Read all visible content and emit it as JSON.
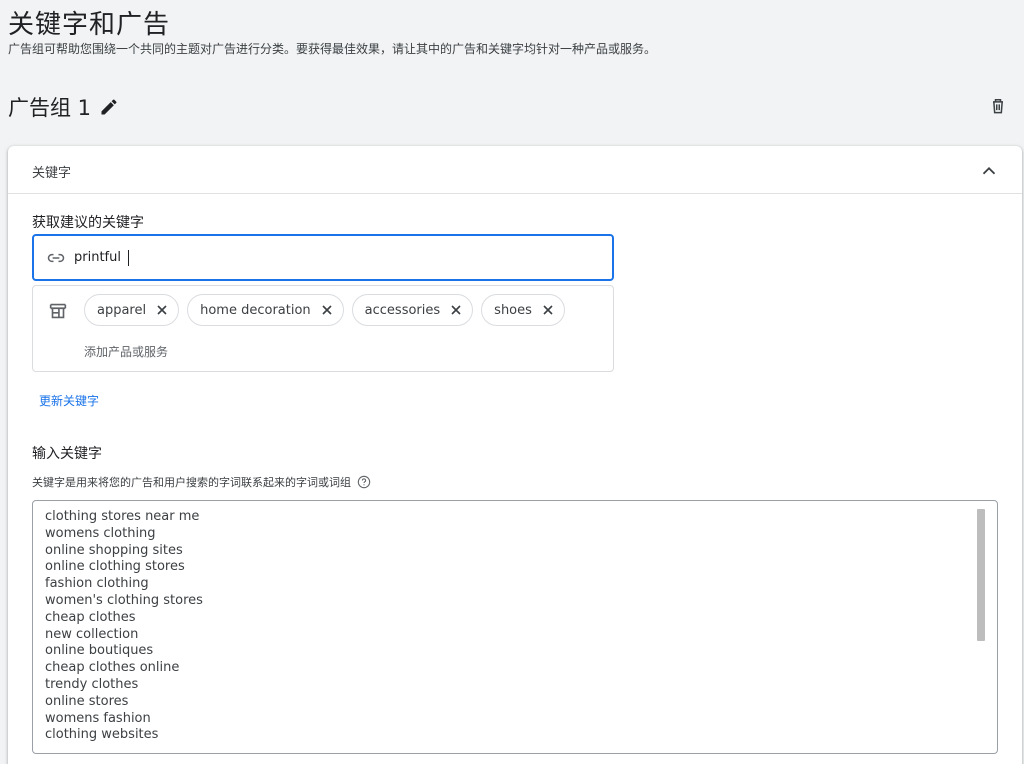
{
  "page": {
    "title": "关键字和广告",
    "subtitle": "广告组可帮助您围绕一个共同的主题对广告进行分类。要获得最佳效果，请让其中的广告和关键字均针对一种产品或服务。"
  },
  "ad_group": {
    "title": "广告组 1",
    "edit_icon": "pencil-icon",
    "delete_icon": "trash-icon"
  },
  "keywords_card": {
    "header": "关键字",
    "collapse_icon": "chevron-up-icon",
    "suggest_label": "获取建议的关键字",
    "url_value": "printful",
    "link_icon": "link-icon",
    "store_icon": "storefront-icon",
    "chips": [
      {
        "label": "apparel"
      },
      {
        "label": "home decoration"
      },
      {
        "label": "accessories"
      },
      {
        "label": "shoes"
      }
    ],
    "add_products_placeholder": "添加产品或服务",
    "update_link": "更新关键字",
    "enter_label": "输入关键字",
    "hint": "关键字是用来将您的广告和用户搜索的字词联系起来的字词或词组",
    "help_icon": "help-circle-icon",
    "keywords": [
      "clothing stores near me",
      "womens clothing",
      "online shopping sites",
      "online clothing stores",
      "fashion clothing",
      "women's clothing stores",
      "cheap clothes",
      "new collection",
      "online boutiques",
      "cheap clothes online",
      "trendy clothes",
      "online stores",
      "womens fashion",
      "clothing websites"
    ]
  },
  "colors": {
    "accent": "#1a73e8",
    "background": "#f1f3f4",
    "text": "#202124"
  }
}
